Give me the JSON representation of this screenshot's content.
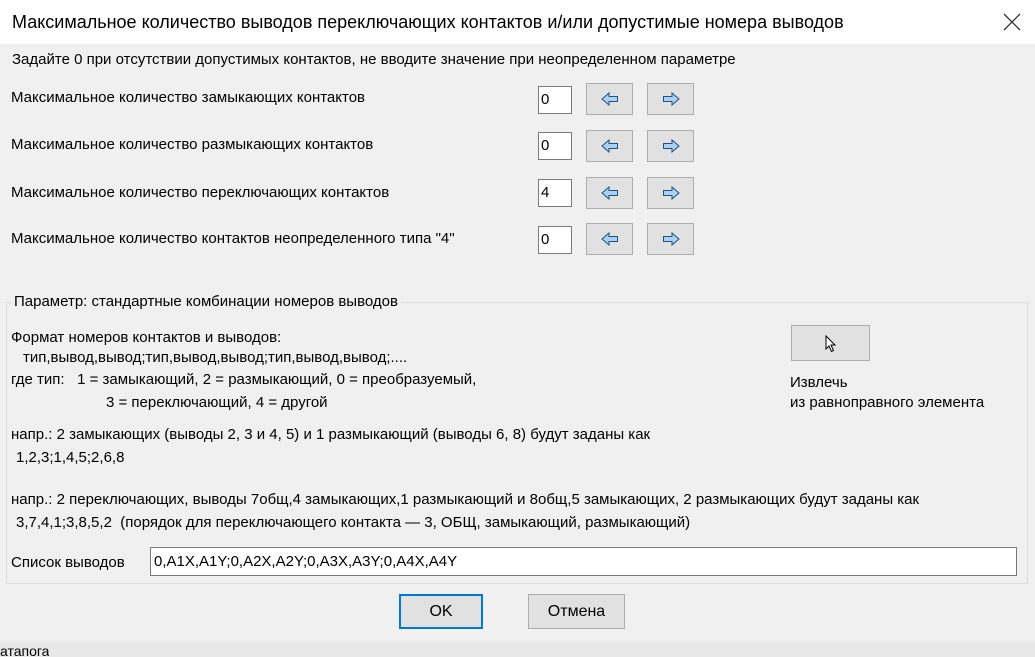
{
  "window": {
    "title": "Максимальное количество выводов переключающих контактов и/или допустимые номера выводов"
  },
  "hint": "Задайте 0 при отсутствии допустимых контактов, не вводите значение при неопределенном параметре",
  "rows": [
    {
      "label": "Максимальное количество замыкающих контактов",
      "value": "0"
    },
    {
      "label": "Максимальное количество размыкающих контактов",
      "value": "0"
    },
    {
      "label": "Максимальное количество переключающих контактов",
      "value": "4"
    },
    {
      "label": "Максимальное количество контактов неопределенного типа \"4\"",
      "value": "0"
    }
  ],
  "icons": {
    "left": "arrow-left-icon",
    "right": "arrow-right-icon",
    "close": "close-icon",
    "cursor": "mouse-cursor-icon"
  },
  "group": {
    "legend": "Параметр: стандартные комбинации номеров выводов",
    "format_title": "Формат номеров контактов и выводов:",
    "format_line": "тип,вывод,вывод;тип,вывод,вывод;тип,вывод,вывод;....",
    "type_line1": "где тип:   1 = замыкающий, 2 = размыкающий, 0 = преобразуемый,",
    "type_line2": "3 = переключающий, 4 = другой",
    "example1_line1": "напр.: 2 замыкающих (выводы 2, 3 и 4, 5) и 1 размыкающий (выводы 6, 8) будут заданы как",
    "example1_line2": "1,2,3;1,4,5;2,6,8",
    "example2_line1": "напр.: 2 переключающих, выводы 7общ,4 замыкающих,1 размыкающий и 8общ,5 замыкающих, 2 размыкающих будут заданы как",
    "example2_line2": "3,7,4,1;3,8,5,2  (порядок для переключающего контакта — 3, ОБЩ, замыкающий, размыкающий)",
    "extract_label_line1": "Извлечь",
    "extract_label_line2": "из равноправного элемента",
    "list_label": "Список выводов",
    "list_value": "0,A1X,A1Y;0,A2X,A2Y;0,A3X,A3Y;0,A4X,A4Y"
  },
  "buttons": {
    "ok": "OK",
    "cancel": "Отмена"
  },
  "background_fragment": "атапога",
  "colors": {
    "accent": "#0078d7",
    "arrow": "#4a90d9"
  }
}
